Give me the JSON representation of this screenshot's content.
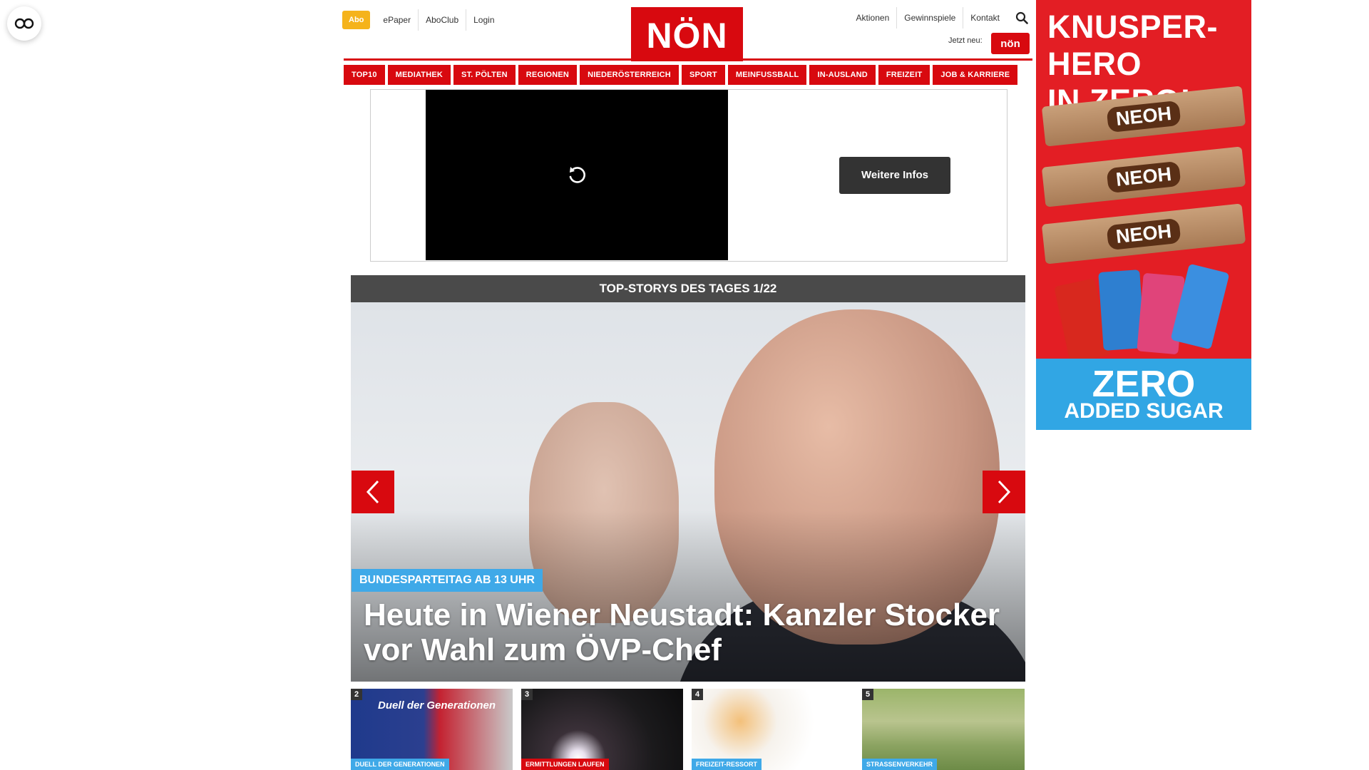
{
  "header": {
    "abo_label": "Abo",
    "meta_left": [
      "ePaper",
      "AboClub",
      "Login"
    ],
    "logo": "NÖN",
    "meta_right": [
      "Aktionen",
      "Gewinnspiele",
      "Kontakt"
    ],
    "jetzt_label": "Jetzt neu:",
    "jetzt_badge": "nön"
  },
  "nav": [
    "TOP10",
    "MEDIATHEK",
    "ST. PÖLTEN",
    "REGIONEN",
    "NIEDERÖSTERREICH",
    "SPORT",
    "MEINFUSSBALL",
    "IN-AUSLAND",
    "FREIZEIT",
    "JOB & KARRIERE"
  ],
  "video_ad": {
    "button_label": "Weitere Infos"
  },
  "top_stories": {
    "header": "TOP-STORYS DES TAGES 1/22",
    "hero_tag": "BUNDESPARTEITAG AB 13 UHR",
    "hero_title": "Heute in Wiener Neustadt: Kanzler Stocker vor Wahl zum ÖVP-Chef",
    "thumbs": [
      {
        "num": "2",
        "tag": "DUELL DER GENERATIONEN",
        "overlay": "Duell der Generationen"
      },
      {
        "num": "3",
        "tag": "ERMITTLUNGEN LAUFEN"
      },
      {
        "num": "4",
        "tag": "FREIZEIT-RESSORT"
      },
      {
        "num": "5",
        "tag": "STRASSENVERKEHR"
      }
    ]
  },
  "side_ad": {
    "headline_1": "KNUSPER-HERO",
    "headline_2": "IN ZERO!",
    "bar_label": "NEOH",
    "zero": "ZERO",
    "sugar": "ADDED SUGAR"
  },
  "colors": {
    "brand_red": "#d8090f",
    "abo_yellow": "#f5b31b",
    "tag_blue": "#3fa9e8"
  }
}
